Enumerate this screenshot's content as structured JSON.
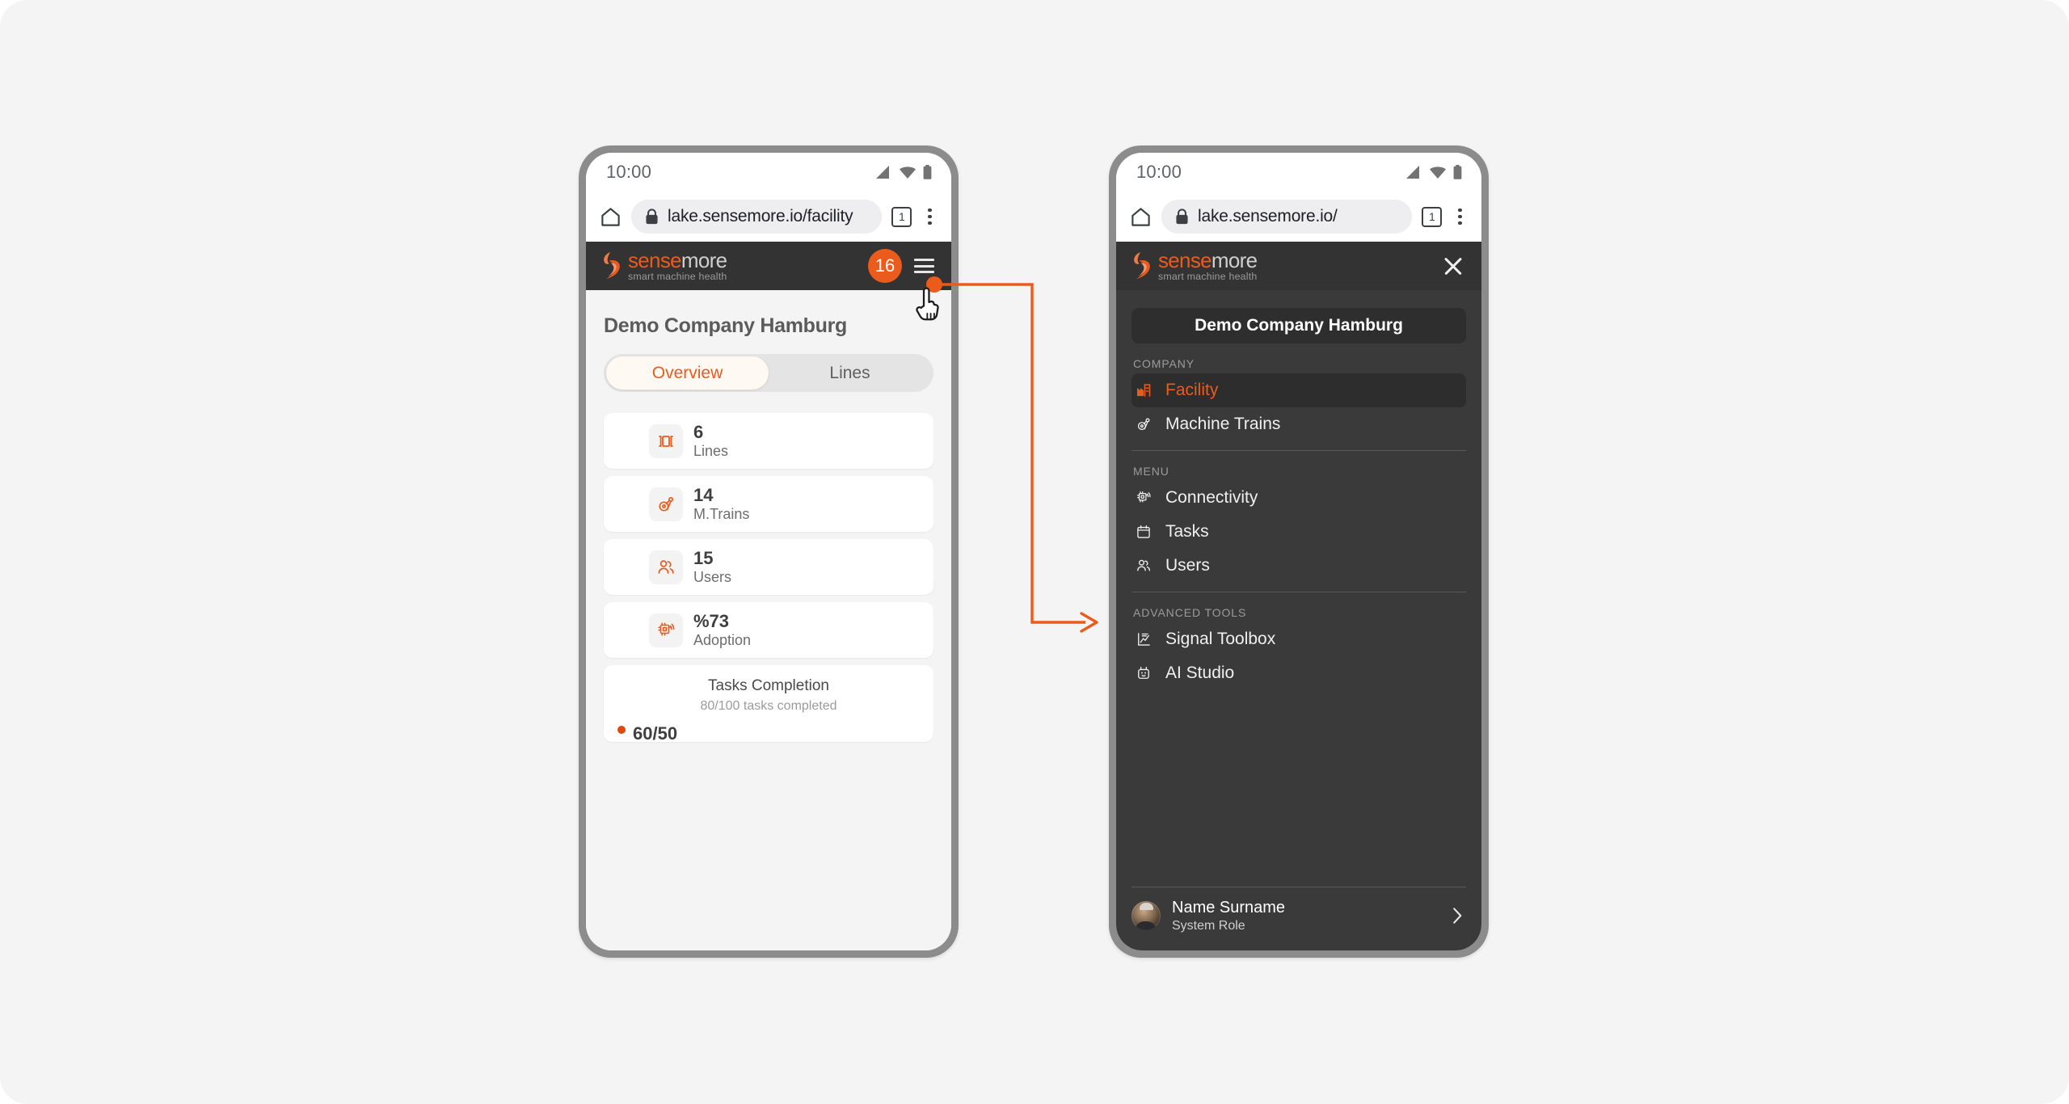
{
  "theme": {
    "accent": "#ea5b1c",
    "accent_dot": "#e0490e",
    "header_dark": "#333333",
    "drawer_dark": "#3a3a3a",
    "drawer_active": "#2d2d2d",
    "page_bg": "#f4f4f4",
    "app_bg": "#f4f4f5",
    "card_bg": "#ffffff",
    "frame_gray": "#8c8c8c"
  },
  "logo": {
    "word_one": "sense",
    "word_two": "more",
    "tagline": "smart machine health",
    "mark": "flame-swoosh-icon"
  },
  "left_phone": {
    "status_bar": {
      "time": "10:00",
      "icons": [
        "signal-icon",
        "wifi-icon",
        "battery-icon"
      ]
    },
    "browser": {
      "home_icon": "home-icon",
      "lock_icon": "lock-icon",
      "url": "lake.sensemore.io/facility",
      "tab_count": "1",
      "menu_icon": "kebab-menu-icon"
    },
    "app_header": {
      "notification_count": "16",
      "menu_icon": "hamburger-menu-icon"
    },
    "page_title": "Demo Company Hamburg",
    "tabs": [
      {
        "label": "Overview",
        "active": true
      },
      {
        "label": "Lines",
        "active": false
      }
    ],
    "stats": [
      {
        "value": "6",
        "label": "Lines",
        "icon": "production-line-icon"
      },
      {
        "value": "14",
        "label": "M.Trains",
        "icon": "machine-train-icon"
      },
      {
        "value": "15",
        "label": "Users",
        "icon": "users-icon"
      },
      {
        "value": "%73",
        "label": "Adoption",
        "icon": "chip-signal-icon"
      }
    ],
    "tasks_card": {
      "title": "Tasks Completion",
      "subtitle": "80/100 tasks completed",
      "legend_value": "60/50",
      "legend_dot_color": "#e0490e"
    }
  },
  "right_phone": {
    "status_bar": {
      "time": "10:00",
      "icons": [
        "signal-icon",
        "wifi-icon",
        "battery-icon"
      ]
    },
    "browser": {
      "home_icon": "home-icon",
      "lock_icon": "lock-icon",
      "url": "lake.sensemore.io/",
      "tab_count": "1",
      "menu_icon": "kebab-menu-icon"
    },
    "app_header": {
      "close_icon": "close-icon"
    },
    "company_name": "Demo Company Hamburg",
    "nav_groups": [
      {
        "label": "COMPANY",
        "items": [
          {
            "label": "Facility",
            "icon": "factory-icon",
            "active": true
          },
          {
            "label": "Machine Trains",
            "icon": "machine-train-icon",
            "active": false
          }
        ]
      },
      {
        "label": "MENU",
        "items": [
          {
            "label": "Connectivity",
            "icon": "chip-signal-icon",
            "active": false
          },
          {
            "label": "Tasks",
            "icon": "calendar-icon",
            "active": false
          },
          {
            "label": "Users",
            "icon": "users-icon",
            "active": false
          }
        ]
      },
      {
        "label": "ADVANCED TOOLS",
        "items": [
          {
            "label": "Signal Toolbox",
            "icon": "signal-chart-icon",
            "active": false
          },
          {
            "label": "AI Studio",
            "icon": "robot-icon",
            "active": false
          }
        ]
      }
    ],
    "user": {
      "name": "Name Surname",
      "role": "System Role",
      "avatar": "user-avatar",
      "chevron": "chevron-right-icon"
    }
  },
  "annotation": {
    "type": "flow-connector",
    "color": "#ea5b1c",
    "from": "hamburger-menu-button",
    "to": "sidebar-drawer",
    "cursor": "pointing-hand-cursor"
  }
}
